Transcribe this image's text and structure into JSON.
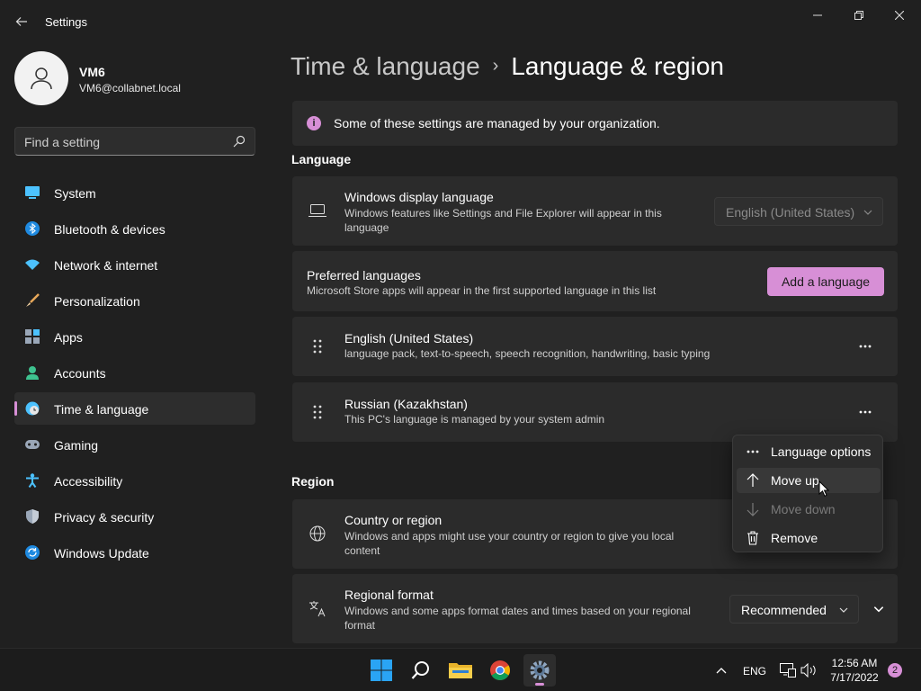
{
  "window": {
    "title": "Settings"
  },
  "user": {
    "name": "VM6",
    "email": "VM6@collabnet.local"
  },
  "search": {
    "placeholder": "Find a setting"
  },
  "nav": [
    {
      "label": "System",
      "icon": "system-icon"
    },
    {
      "label": "Bluetooth & devices",
      "icon": "bluetooth-icon"
    },
    {
      "label": "Network & internet",
      "icon": "wifi-icon"
    },
    {
      "label": "Personalization",
      "icon": "brush-icon"
    },
    {
      "label": "Apps",
      "icon": "apps-icon"
    },
    {
      "label": "Accounts",
      "icon": "person-icon"
    },
    {
      "label": "Time & language",
      "icon": "clock-globe-icon",
      "active": true
    },
    {
      "label": "Gaming",
      "icon": "gamepad-icon"
    },
    {
      "label": "Accessibility",
      "icon": "accessibility-icon"
    },
    {
      "label": "Privacy & security",
      "icon": "shield-icon"
    },
    {
      "label": "Windows Update",
      "icon": "update-icon"
    }
  ],
  "breadcrumb": {
    "parent": "Time & language",
    "current": "Language & region"
  },
  "banner": {
    "text": "Some of these settings are managed by your organization."
  },
  "language": {
    "section_title": "Language",
    "display": {
      "title": "Windows display language",
      "subtitle": "Windows features like Settings and File Explorer will appear in this language",
      "value": "English (United States)"
    },
    "preferred": {
      "title": "Preferred languages",
      "subtitle": "Microsoft Store apps will appear in the first supported language in this list",
      "add_label": "Add a language"
    },
    "items": [
      {
        "name": "English (United States)",
        "detail": "language pack, text-to-speech, speech recognition, handwriting, basic typing"
      },
      {
        "name": "Russian (Kazakhstan)",
        "detail": "This PC's language is managed by your system admin"
      }
    ]
  },
  "context_menu": {
    "items": [
      {
        "label": "Language options",
        "icon": "more-horizontal-icon"
      },
      {
        "label": "Move up",
        "icon": "arrow-up-icon",
        "hover": true
      },
      {
        "label": "Move down",
        "icon": "arrow-down-icon",
        "disabled": true
      },
      {
        "label": "Remove",
        "icon": "trash-icon"
      }
    ]
  },
  "region": {
    "section_title": "Region",
    "country": {
      "title": "Country or region",
      "subtitle": "Windows and apps might use your country or region to give you local content"
    },
    "format": {
      "title": "Regional format",
      "subtitle": "Windows and some apps format dates and times based on your regional format",
      "value": "Recommended"
    }
  },
  "taskbar": {
    "language": "ENG",
    "time": "12:56 AM",
    "date": "7/17/2022",
    "notifications": "2"
  },
  "colors": {
    "accent": "#d78fd6",
    "background": "#202020",
    "card": "#2b2b2b"
  }
}
